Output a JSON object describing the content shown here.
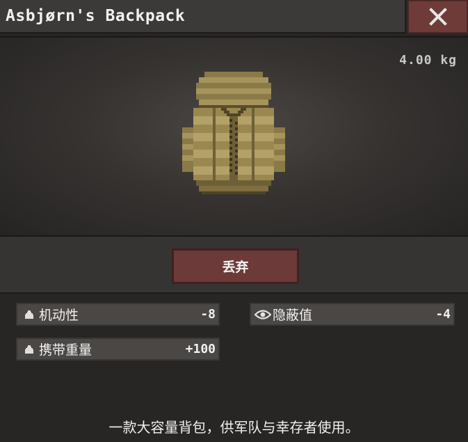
{
  "window": {
    "title": "Asbjørn's Backpack"
  },
  "item": {
    "weight": "4.00 kg",
    "icon": "backpack-icon"
  },
  "actions": {
    "discard_label": "丢弃"
  },
  "stats": {
    "mobility": {
      "label": "机动性",
      "value": "-8",
      "icon": "weight-icon"
    },
    "stealth": {
      "label": "隐蔽值",
      "value": "-4",
      "icon": "eye-icon"
    },
    "carry": {
      "label": "携带重量",
      "value": "+100",
      "icon": "weight-icon"
    }
  },
  "description": "一款大容量背包，供军队与幸存者使用。",
  "colors": {
    "close_button": "#6e3b39",
    "discard_button": "#6c3a38",
    "backpack": "#9a8850"
  }
}
